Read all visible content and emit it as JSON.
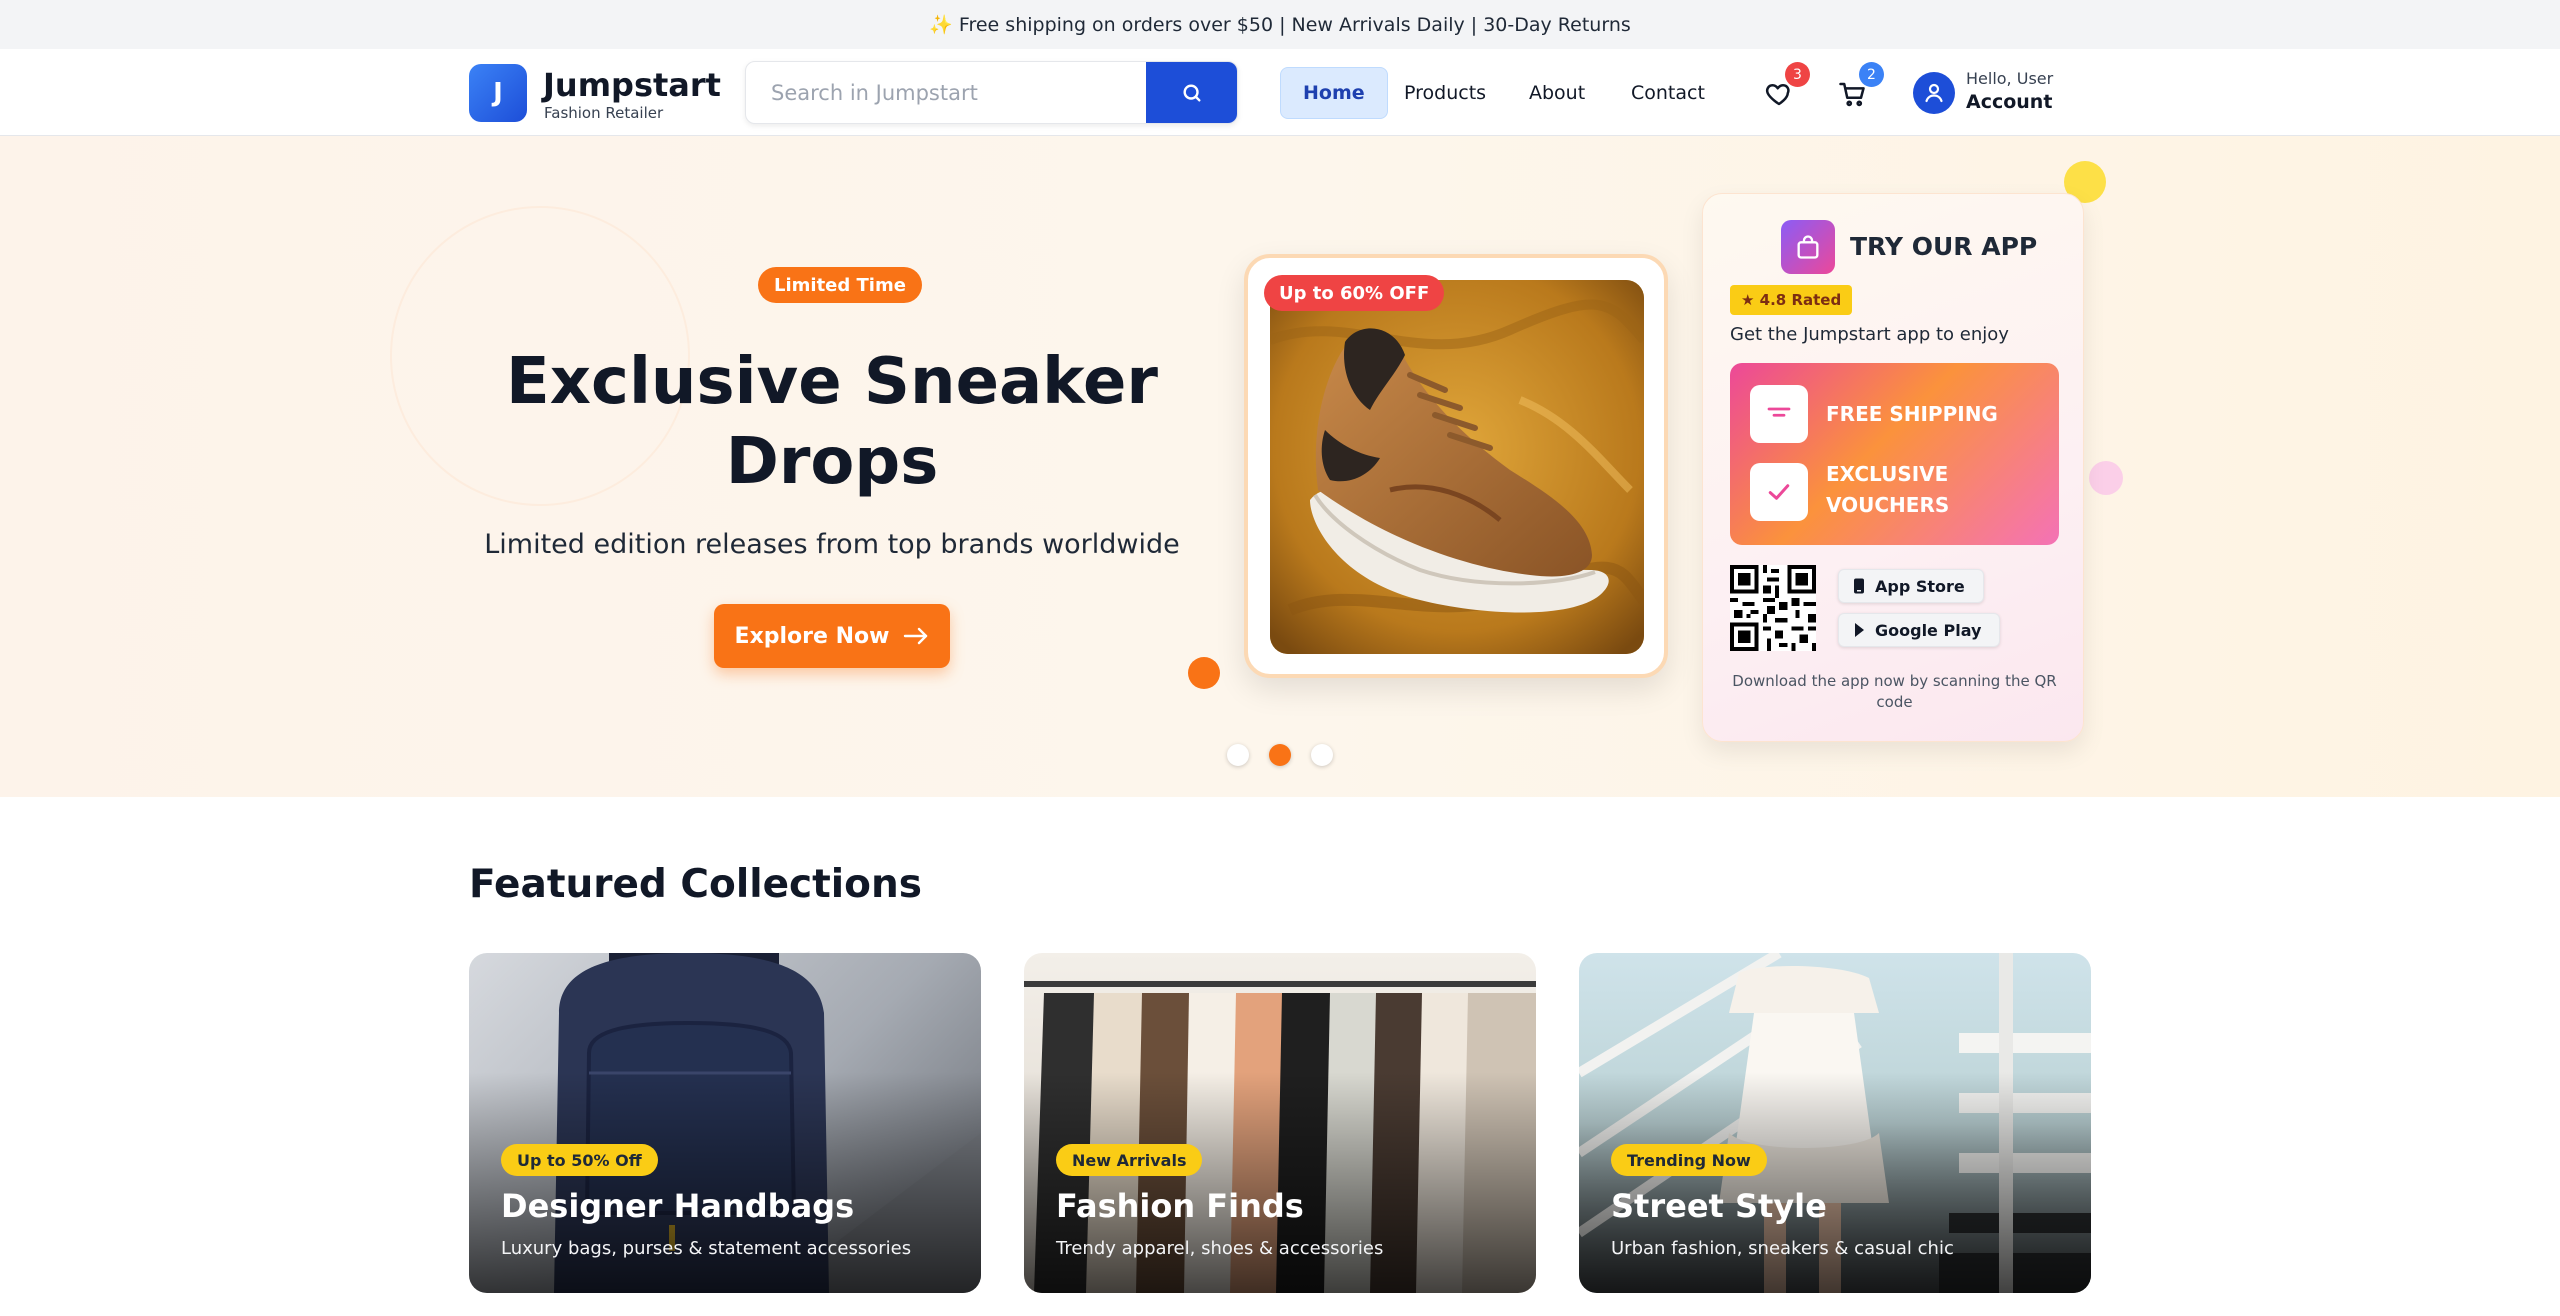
{
  "announcement": "✨ Free shipping on orders over $50 | New Arrivals Daily | 30-Day Returns",
  "brand": {
    "initial": "J",
    "name": "Jumpstart",
    "tagline": "Fashion Retailer",
    "color": "#1d4ed8"
  },
  "search": {
    "placeholder": "Search in Jumpstart",
    "value": ""
  },
  "nav": [
    {
      "label": "Home",
      "active": true
    },
    {
      "label": "Products",
      "active": false
    },
    {
      "label": "About",
      "active": false
    },
    {
      "label": "Contact",
      "active": false
    }
  ],
  "wishlist": {
    "icon": "heart-icon",
    "count": "3",
    "badge_color": "#ef4444"
  },
  "cart": {
    "icon": "cart-icon",
    "count": "2",
    "badge_color": "#3b82f6"
  },
  "account": {
    "icon": "user-icon",
    "greeting": "Hello, User",
    "label": "Account"
  },
  "hero": {
    "badge": "Limited Time",
    "title": "Exclusive Sneaker Drops",
    "subtitle": "Limited edition releases from top brands worldwide",
    "cta": "Explore Now",
    "discount_badge": "Up to 60% OFF",
    "image_subject": "sneaker-on-mustard-fabric",
    "slides": 3,
    "active_slide": 2,
    "accent": "#f97316"
  },
  "app_promo": {
    "title": "TRY OUR APP",
    "rating": "★ 4.8 Rated",
    "description": "Get the Jumpstart app to enjoy",
    "perks": [
      "FREE SHIPPING",
      "EXCLUSIVE VOUCHERS"
    ],
    "stores": [
      "App Store",
      "Google Play"
    ],
    "footer": "Download the app now by scanning the QR code"
  },
  "featured": {
    "title": "Featured Collections",
    "collections": [
      {
        "badge": "Up to 50% Off",
        "name": "Designer Handbags",
        "description": "Luxury bags, purses & statement accessories"
      },
      {
        "badge": "New Arrivals",
        "name": "Fashion Finds",
        "description": "Trendy apparel, shoes & accessories"
      },
      {
        "badge": "Trending Now",
        "name": "Street Style",
        "description": "Urban fashion, sneakers & casual chic"
      }
    ]
  }
}
